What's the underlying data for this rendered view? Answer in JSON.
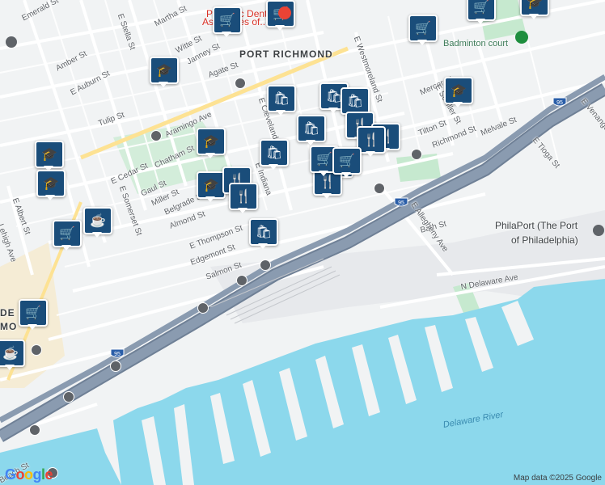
{
  "colors": {
    "water": "#8cd8ec",
    "park": "#c6e9cf",
    "highway": "#8a9bb0",
    "highway_edge": "#6f8096",
    "street": "#ffffff",
    "land": "#f1f3f4",
    "port": "#e7e9ec",
    "marker": "#1a4d7a",
    "sand": "#f5ecd5"
  },
  "labels": [
    {
      "text": "Emerald St",
      "kind": "street"
    },
    {
      "text": "Amber St",
      "kind": "street"
    },
    {
      "text": "E Auburn St",
      "kind": "street"
    },
    {
      "text": "Martha St",
      "kind": "street"
    },
    {
      "text": "E Stella St",
      "kind": "street"
    },
    {
      "text": "Witte St",
      "kind": "street"
    },
    {
      "text": "Janney St",
      "kind": "street"
    },
    {
      "text": "Agate St",
      "kind": "street"
    },
    {
      "text": "Aramingo Ave",
      "kind": "street"
    },
    {
      "text": "Tulip St",
      "kind": "street"
    },
    {
      "text": "E Cedar St",
      "kind": "street"
    },
    {
      "text": "Chatham St",
      "kind": "street"
    },
    {
      "text": "Gaul St",
      "kind": "street"
    },
    {
      "text": "Miller St",
      "kind": "street"
    },
    {
      "text": "Belgrade St",
      "kind": "street"
    },
    {
      "text": "Almond St",
      "kind": "street"
    },
    {
      "text": "E Thompson St",
      "kind": "street"
    },
    {
      "text": "Edgemont St",
      "kind": "street"
    },
    {
      "text": "Salmon St",
      "kind": "street"
    },
    {
      "text": "E Somerset St",
      "kind": "street"
    },
    {
      "text": "E Albert St",
      "kind": "street"
    },
    {
      "text": "Lehigh Ave",
      "kind": "street"
    },
    {
      "text": "Richmond St",
      "kind": "street"
    },
    {
      "text": "E Westmoreland St",
      "kind": "street"
    },
    {
      "text": "Mercer St",
      "kind": "street"
    },
    {
      "text": "E Schiller St",
      "kind": "street"
    },
    {
      "text": "Tilton St",
      "kind": "street"
    },
    {
      "text": "Melvale St",
      "kind": "street"
    },
    {
      "text": "E Tioga St",
      "kind": "street"
    },
    {
      "text": "E Venango St",
      "kind": "street"
    },
    {
      "text": "Bath St",
      "kind": "street"
    },
    {
      "text": "E Allegheny Ave",
      "kind": "street"
    },
    {
      "text": "N Delaware Ave",
      "kind": "street"
    },
    {
      "text": "Beach St",
      "kind": "street"
    },
    {
      "text": "E Cleveland St",
      "kind": "street"
    },
    {
      "text": "E Indiana",
      "kind": "street"
    },
    {
      "text": "Emerald St",
      "kind": "street"
    },
    {
      "text": "Pediatric Dental",
      "kind": "poi-red"
    },
    {
      "text": "Associates of...",
      "kind": "poi-red"
    },
    {
      "text": "PORT RICHMOND",
      "kind": "big"
    },
    {
      "text": "Badminton court",
      "kind": "poi"
    },
    {
      "text": "PhilaPort (The Port",
      "kind": "dark"
    },
    {
      "text": "of Philadelphia)",
      "kind": "dark"
    },
    {
      "text": "Delaware River",
      "kind": "water"
    },
    {
      "text": "DE",
      "kind": "big"
    },
    {
      "text": "MO",
      "kind": "big"
    },
    {
      "text": "95",
      "kind": "shield"
    }
  ],
  "markers": [
    {
      "icon": "cart-icon",
      "glyph": "🛒"
    },
    {
      "icon": "cart-icon",
      "glyph": "🛒"
    },
    {
      "icon": "cart-icon",
      "glyph": "🛒"
    },
    {
      "icon": "cart-icon",
      "glyph": "🛒"
    },
    {
      "icon": "school-icon",
      "glyph": "🎓"
    },
    {
      "icon": "school-icon",
      "glyph": "🎓"
    },
    {
      "icon": "school-icon",
      "glyph": "🎓"
    },
    {
      "icon": "school-icon",
      "glyph": "🎓"
    },
    {
      "icon": "school-icon",
      "glyph": "🎓"
    },
    {
      "icon": "school-icon",
      "glyph": "🎓"
    },
    {
      "icon": "school-icon",
      "glyph": "🎓"
    },
    {
      "icon": "shopping-bag-icon",
      "glyph": "🛍"
    },
    {
      "icon": "shopping-bag-icon",
      "glyph": "🛍"
    },
    {
      "icon": "shopping-bag-icon",
      "glyph": "🛍"
    },
    {
      "icon": "shopping-bag-icon",
      "glyph": "🛍"
    },
    {
      "icon": "shopping-bag-icon",
      "glyph": "🛍"
    },
    {
      "icon": "shopping-bag-icon",
      "glyph": "🛍"
    },
    {
      "icon": "restaurant-icon",
      "glyph": "🍴"
    },
    {
      "icon": "restaurant-icon",
      "glyph": "🍴"
    },
    {
      "icon": "restaurant-icon",
      "glyph": "🍴"
    },
    {
      "icon": "restaurant-icon",
      "glyph": "🍴"
    },
    {
      "icon": "restaurant-icon",
      "glyph": "🍴"
    },
    {
      "icon": "restaurant-icon",
      "glyph": "🍴"
    },
    {
      "icon": "restaurant-icon",
      "glyph": "🍴"
    },
    {
      "icon": "cafe-icon",
      "glyph": "☕"
    },
    {
      "icon": "cafe-icon",
      "glyph": "☕"
    },
    {
      "icon": "cart-icon",
      "glyph": "🛒"
    },
    {
      "icon": "cart-icon",
      "glyph": "🛒"
    },
    {
      "icon": "cart-icon",
      "glyph": "🛒"
    },
    {
      "icon": "cart-icon",
      "glyph": "🛒"
    }
  ],
  "footer": {
    "logo": "Google",
    "attribution": "Map data ©2025 Google"
  }
}
